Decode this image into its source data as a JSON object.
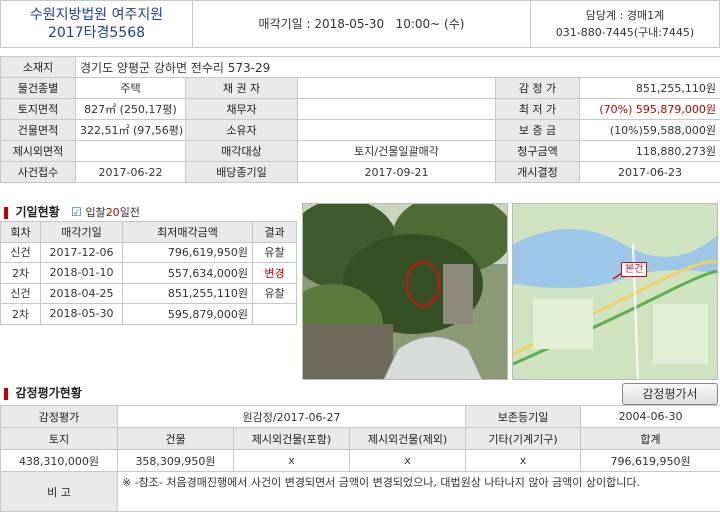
{
  "header": {
    "court": "수원지방법원 여주지원",
    "case_no": "2017타경5568",
    "sale_label": "매각기일",
    "sale_value": ": 2018-05-30   10:00~ (수)",
    "dept": "담당계 : 경매1계",
    "phone": "031-880-7445(구내:7445)"
  },
  "summary": {
    "address_label": "소재지",
    "address": "경기도 양평군 강하면 전수리 573-29",
    "rows": [
      [
        "물건종별",
        "주택",
        "채 권 자",
        "",
        "감 정 가",
        "851,255,110원"
      ],
      [
        "토지면적",
        "827㎡ (250,17평)",
        "채무자",
        "",
        "최 저 가",
        "(70%) 595,879,000원"
      ],
      [
        "건물면적",
        "322,51㎡ (97,56평)",
        "소유자",
        "",
        "보 증 금",
        "(10%)59,588,000원"
      ],
      [
        "제시외면적",
        "",
        "매각대상",
        "토지/건물일괄매각",
        "청구금액",
        "118,880,273원"
      ],
      [
        "사건접수",
        "2017-06-22",
        "배당종기일",
        "2017-09-21",
        "개시결정",
        "2017-06-23"
      ]
    ]
  },
  "history": {
    "title": "기일현황",
    "bid_prefix": "입찰",
    "bid_days": "20",
    "bid_suffix": "일전",
    "headers": [
      "회차",
      "매각기일",
      "최저매각금액",
      "결과"
    ],
    "rows": [
      [
        "신건",
        "2017-12-06",
        "796,619,950원",
        "유찰"
      ],
      [
        "2차",
        "2018-01-10",
        "557,634,000원",
        "변경"
      ],
      [
        "신건",
        "2018-04-25",
        "851,255,110원",
        "유찰"
      ],
      [
        "2차",
        "2018-05-30",
        "595,879,000원",
        ""
      ]
    ]
  },
  "map": {
    "marker": "본건"
  },
  "appraisal": {
    "title": "감정평가현황",
    "button": "감정평가서",
    "row1": [
      "감정평가",
      "원감정/2017-06-27",
      "보존등기일",
      "2004-06-30"
    ],
    "headers": [
      "토지",
      "건물",
      "제시외건물(포함)",
      "제시외건물(제외)",
      "기타(기계기구)",
      "합계"
    ],
    "values": [
      "438,310,000원",
      "358,309,950원",
      "x",
      "x",
      "x",
      "796,619,950원"
    ],
    "note_label": "비 고",
    "note": "※ -참조- 처음경매진행에서 사건이 변경되면서 금액이 변경되었으나, 대법원상 나타나지 않아 금액이 상이합니다."
  },
  "colors": {
    "court_blue": "#1f3fa0",
    "red": "#b30000",
    "label_bg": "#e9e9e9",
    "accent": "#c00000"
  }
}
